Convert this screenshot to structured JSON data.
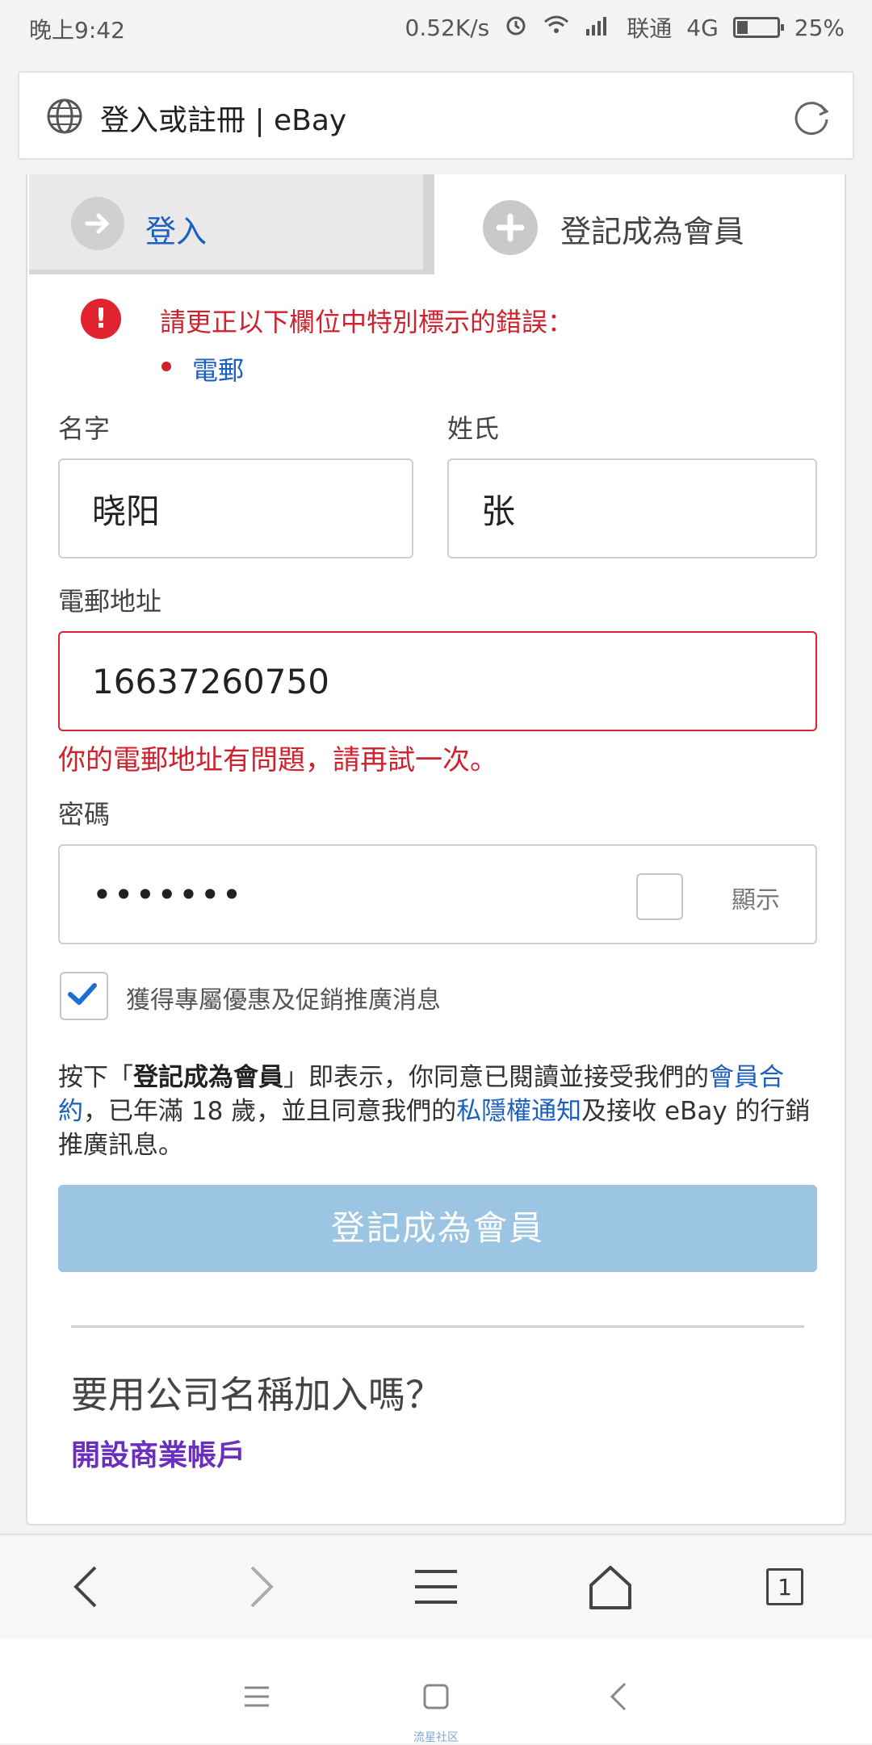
{
  "status_bar": {
    "time": "晚上9:42",
    "net_speed": "0.52K/s",
    "carrier": "联通",
    "network": "4G",
    "battery": "25%",
    "battery_level": 0.25
  },
  "browser": {
    "page_title": "登入或註冊 | eBay"
  },
  "tabs": {
    "signin": "登入",
    "register": "登記成為會員"
  },
  "errors": {
    "summary": "請更正以下欄位中特別標示的錯誤：",
    "items": [
      "電郵"
    ]
  },
  "form": {
    "first_name_label": "名字",
    "first_name_value": "晓阳",
    "last_name_label": "姓氏",
    "last_name_value": "张",
    "email_label": "電郵地址",
    "email_value": "16637260750",
    "email_error": "你的電郵地址有問題，請再試一次。",
    "password_label": "密碼",
    "password_value": "•••••••",
    "show_password_label": "顯示",
    "promo_label": "獲得專屬優惠及促銷推廣消息",
    "promo_checked": true
  },
  "legal": {
    "part1": "按下「",
    "bold": "登記成為會員",
    "part2": "」即表示，你同意已閱讀並接受我們的",
    "link1": "會員合約",
    "part3": "，已年滿 18 歲，並且同意我們的",
    "link2": "私隱權通知",
    "part4": "及接收 eBay 的行銷推廣訊息。"
  },
  "submit_label": "登記成為會員",
  "business": {
    "question": "要用公司名稱加入嗎？",
    "link": "開設商業帳戶"
  },
  "toolbar": {
    "tab_count": "1"
  },
  "watermark": "流星社区",
  "colors": {
    "error": "#d0212c",
    "link": "#1b5fbf",
    "submit_disabled": "#9cc5e3",
    "business_link": "#6b2fbf"
  }
}
